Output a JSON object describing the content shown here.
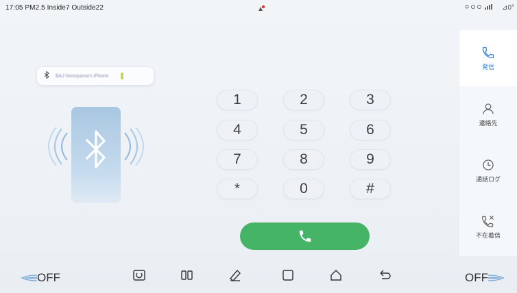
{
  "status_bar": {
    "text": "17:05 PM2.5 Inside7 Outside22",
    "right_text": "⊿0°"
  },
  "device": {
    "name": "BAJ Nonoyama's iPhone"
  },
  "keypad": {
    "keys": [
      "1",
      "2",
      "3",
      "4",
      "5",
      "6",
      "7",
      "8",
      "9",
      "*",
      "0",
      "#"
    ]
  },
  "sidebar": {
    "items": [
      {
        "label": "発信",
        "icon": "phone-icon",
        "active": true
      },
      {
        "label": "連絡先",
        "icon": "person-icon",
        "active": false
      },
      {
        "label": "通話ログ",
        "icon": "clock-icon",
        "active": false
      },
      {
        "label": "不在着信",
        "icon": "missed-call-icon",
        "active": false
      }
    ]
  },
  "bottom_bar": {
    "left_fan": "OFF",
    "right_fan": "OFF",
    "nav_icons": [
      "camera-icon",
      "split-screen-icon",
      "edit-icon",
      "square-icon",
      "home-icon",
      "back-icon"
    ]
  },
  "colors": {
    "accent": "#2f7fe0",
    "call_green": "#45b467",
    "background": "#eef2f6"
  }
}
